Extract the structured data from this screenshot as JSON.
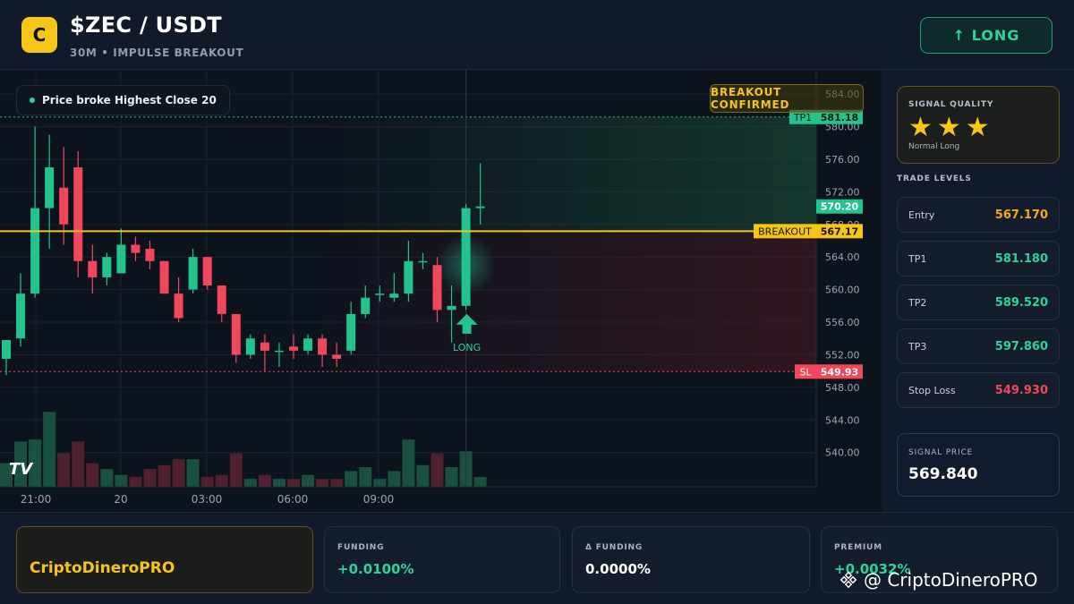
{
  "header": {
    "logo_letter": "C",
    "pair": "$ZEC / USDT",
    "subtitle": "30M • IMPULSE BREAKOUT",
    "long_button": "↑ LONG"
  },
  "chart": {
    "info_pill": "Price broke Highest Close 20",
    "breakout_badge": "BREAKOUT CONFIRMED",
    "tv_logo": "TV",
    "long_marker": "LONG",
    "axis_labels": [
      "584.00",
      "580.00",
      "576.00",
      "572.00",
      "568.00",
      "564.00",
      "560.00",
      "556.00",
      "552.00",
      "548.00",
      "544.00",
      "540.00"
    ],
    "time_labels": [
      "21:00",
      "20",
      "03:00",
      "06:00",
      "09:00"
    ],
    "tags": {
      "tp1": {
        "label": "TP1",
        "value": "581.18"
      },
      "current": {
        "value": "570.20"
      },
      "breakout": {
        "label": "BREAKOUT",
        "value": "567.17"
      },
      "sl": {
        "label": "SL",
        "value": "549.93"
      }
    },
    "colors": {
      "up": "#22c38e",
      "down": "#f0475c",
      "breakout": "#f5c518"
    }
  },
  "chart_data": {
    "type": "candlestick",
    "y_range": [
      537,
      585
    ],
    "levels": {
      "tp1": 581.18,
      "breakout": 567.17,
      "sl": 549.93,
      "current": 570.2
    },
    "candles": [
      {
        "o": 551.5,
        "h": 553.5,
        "l": 549.5,
        "c": 553.8
      },
      {
        "o": 554,
        "h": 562,
        "l": 553,
        "c": 559.5
      },
      {
        "o": 559.5,
        "h": 580,
        "l": 559,
        "c": 570
      },
      {
        "o": 570,
        "h": 579,
        "l": 565,
        "c": 575
      },
      {
        "o": 572.5,
        "h": 577.5,
        "l": 565.5,
        "c": 568
      },
      {
        "o": 575,
        "h": 577,
        "l": 561.5,
        "c": 563.5
      },
      {
        "o": 563.5,
        "h": 565.5,
        "l": 559.5,
        "c": 561.5
      },
      {
        "o": 561.5,
        "h": 564.5,
        "l": 560.5,
        "c": 564
      },
      {
        "o": 562,
        "h": 567.5,
        "l": 562,
        "c": 565.5
      },
      {
        "o": 565.5,
        "h": 566.5,
        "l": 563.5,
        "c": 564.5
      },
      {
        "o": 565,
        "h": 566,
        "l": 562.5,
        "c": 563.5
      },
      {
        "o": 563.5,
        "h": 563.5,
        "l": 561.5,
        "c": 559.5
      },
      {
        "o": 559.5,
        "h": 561.5,
        "l": 556,
        "c": 556.5
      },
      {
        "o": 560,
        "h": 565,
        "l": 559.5,
        "c": 564
      },
      {
        "o": 564,
        "h": 564,
        "l": 560,
        "c": 560.5
      },
      {
        "o": 560.5,
        "h": 560.5,
        "l": 556,
        "c": 557
      },
      {
        "o": 557,
        "h": 557,
        "l": 551,
        "c": 552
      },
      {
        "o": 552,
        "h": 554.5,
        "l": 551.5,
        "c": 554
      },
      {
        "o": 553.5,
        "h": 554.5,
        "l": 550,
        "c": 552.5
      },
      {
        "o": 552.5,
        "h": 553.5,
        "l": 550.5,
        "c": 552.5
      },
      {
        "o": 553,
        "h": 554.5,
        "l": 551.5,
        "c": 552.5
      },
      {
        "o": 552.5,
        "h": 554.5,
        "l": 552,
        "c": 554
      },
      {
        "o": 554,
        "h": 554.5,
        "l": 550.5,
        "c": 552
      },
      {
        "o": 552,
        "h": 553.5,
        "l": 550.5,
        "c": 551.5
      },
      {
        "o": 552.5,
        "h": 558.5,
        "l": 552,
        "c": 557
      },
      {
        "o": 557,
        "h": 560.5,
        "l": 556.5,
        "c": 559
      },
      {
        "o": 559.5,
        "h": 560.5,
        "l": 558.5,
        "c": 559.5
      },
      {
        "o": 559,
        "h": 562,
        "l": 558.5,
        "c": 559.5
      },
      {
        "o": 559.5,
        "h": 566,
        "l": 558.5,
        "c": 563.5
      },
      {
        "o": 563.5,
        "h": 564.5,
        "l": 562.5,
        "c": 563.5
      },
      {
        "o": 563,
        "h": 564,
        "l": 556,
        "c": 557.5
      },
      {
        "o": 557.5,
        "h": 560.5,
        "l": 553.5,
        "c": 558
      },
      {
        "o": 558,
        "h": 570.5,
        "l": 557.5,
        "c": 570
      },
      {
        "o": 570,
        "h": 575.5,
        "l": 568,
        "c": 570.2
      }
    ],
    "volume": [
      1.2,
      2.3,
      2.4,
      3.8,
      1.7,
      2.3,
      1.2,
      0.9,
      0.6,
      0.5,
      0.9,
      1.1,
      1.4,
      1.4,
      0.5,
      0.6,
      1.7,
      0.4,
      0.6,
      0.4,
      0.4,
      0.6,
      0.4,
      0.4,
      0.8,
      1.0,
      0.4,
      0.8,
      2.4,
      1.1,
      1.7,
      1.0,
      1.8,
      0.5
    ]
  },
  "panel": {
    "signal_quality_title": "SIGNAL QUALITY",
    "stars": "★★★",
    "signal_quality_sub": "Normal Long",
    "trade_levels_title": "TRADE LEVELS",
    "levels": [
      {
        "label": "Entry",
        "value": "567.170",
        "color": "#f5a623"
      },
      {
        "label": "TP1",
        "value": "581.180",
        "color": "#2fd39a"
      },
      {
        "label": "TP2",
        "value": "589.520",
        "color": "#2fd39a"
      },
      {
        "label": "TP3",
        "value": "597.860",
        "color": "#2fd39a"
      },
      {
        "label": "Stop Loss",
        "value": "549.930",
        "color": "#f0475c"
      }
    ],
    "signal_price_title": "SIGNAL PRICE",
    "signal_price": "569.840"
  },
  "footer": {
    "brand": "CriptoDineroPRO",
    "funding_title": "FUNDING",
    "funding_value": "+0.0100%",
    "dfunding_title": "Δ FUNDING",
    "dfunding_value": "0.0000%",
    "premium_title": "PREMIUM",
    "premium_value": "+0.0032%",
    "watermark": "@ CriptoDineroPRO"
  }
}
